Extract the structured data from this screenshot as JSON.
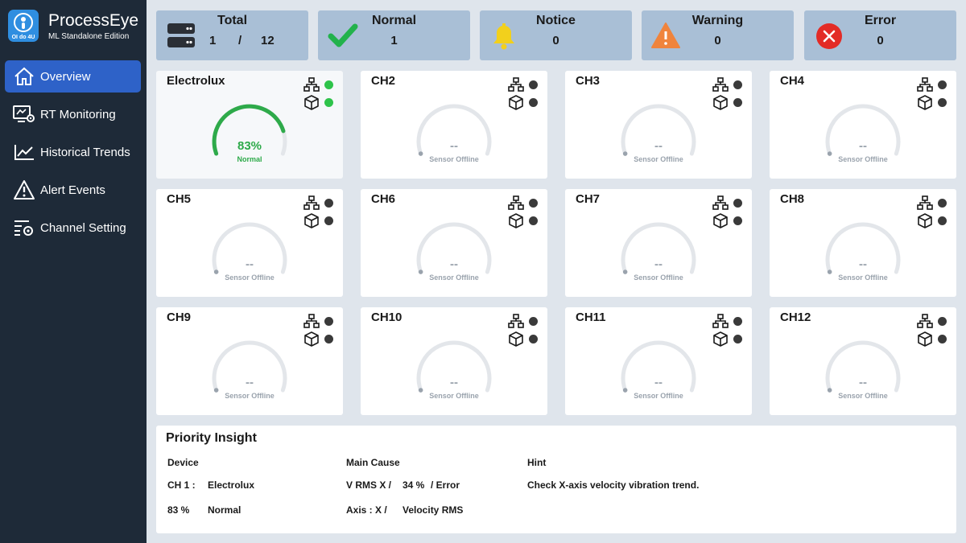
{
  "app": {
    "name": "ProcessEye",
    "edition": "ML Standalone Edition",
    "logo_text": "OI do 4U"
  },
  "nav": [
    {
      "label": "Overview",
      "icon": "home-icon",
      "active": true
    },
    {
      "label": "RT Monitoring",
      "icon": "monitor-settings-icon",
      "active": false
    },
    {
      "label": "Historical Trends",
      "icon": "line-chart-icon",
      "active": false
    },
    {
      "label": "Alert Events",
      "icon": "warning-triangle-icon",
      "active": false
    },
    {
      "label": "Channel Setting",
      "icon": "settings-list-icon",
      "active": false
    }
  ],
  "summary": {
    "total": {
      "title": "Total",
      "current": "1",
      "separator": "/",
      "max": "12",
      "icon": "server-icon"
    },
    "normal": {
      "title": "Normal",
      "value": "1",
      "icon": "checkmark-icon",
      "color": "#22b24c"
    },
    "notice": {
      "title": "Notice",
      "value": "0",
      "icon": "bell-icon",
      "color": "#f2d01c"
    },
    "warning": {
      "title": "Warning",
      "value": "0",
      "icon": "warning-icon",
      "color": "#f0843c"
    },
    "error": {
      "title": "Error",
      "value": "0",
      "icon": "error-x-icon",
      "color": "#e32b26"
    }
  },
  "channels": [
    {
      "name": "Electrolux",
      "value": "83%",
      "status": "Normal",
      "level": 0.83,
      "online": true
    },
    {
      "name": "CH2",
      "value": "--",
      "status": "Sensor Offline",
      "level": 0,
      "online": false
    },
    {
      "name": "CH3",
      "value": "--",
      "status": "Sensor Offline",
      "level": 0,
      "online": false
    },
    {
      "name": "CH4",
      "value": "--",
      "status": "Sensor Offline",
      "level": 0,
      "online": false
    },
    {
      "name": "CH5",
      "value": "--",
      "status": "Sensor Offline",
      "level": 0,
      "online": false
    },
    {
      "name": "CH6",
      "value": "--",
      "status": "Sensor Offline",
      "level": 0,
      "online": false
    },
    {
      "name": "CH7",
      "value": "--",
      "status": "Sensor Offline",
      "level": 0,
      "online": false
    },
    {
      "name": "CH8",
      "value": "--",
      "status": "Sensor Offline",
      "level": 0,
      "online": false
    },
    {
      "name": "CH9",
      "value": "--",
      "status": "Sensor Offline",
      "level": 0,
      "online": false
    },
    {
      "name": "CH10",
      "value": "--",
      "status": "Sensor Offline",
      "level": 0,
      "online": false
    },
    {
      "name": "CH11",
      "value": "--",
      "status": "Sensor Offline",
      "level": 0,
      "online": false
    },
    {
      "name": "CH12",
      "value": "--",
      "status": "Sensor Offline",
      "level": 0,
      "online": false
    }
  ],
  "colors": {
    "online": "#2ec34a",
    "offline": "#3a3a3a",
    "gauge_track": "#e3e6ea",
    "gauge_fill": "#2eaa4a",
    "accent": "#2e62c8"
  },
  "insight": {
    "title": "Priority Insight",
    "headers": {
      "device": "Device",
      "cause": "Main Cause",
      "hint": "Hint"
    },
    "row1": {
      "channel": "CH 1 :",
      "device": "Electrolux",
      "cause_a": "V RMS X /",
      "cause_b": "34 %",
      "cause_c": "/ Error",
      "hint": "Check X-axis velocity vibration trend."
    },
    "row2": {
      "level": "83 %",
      "status": "Normal",
      "axis": "Axis : X /",
      "metric": "Velocity RMS"
    }
  }
}
